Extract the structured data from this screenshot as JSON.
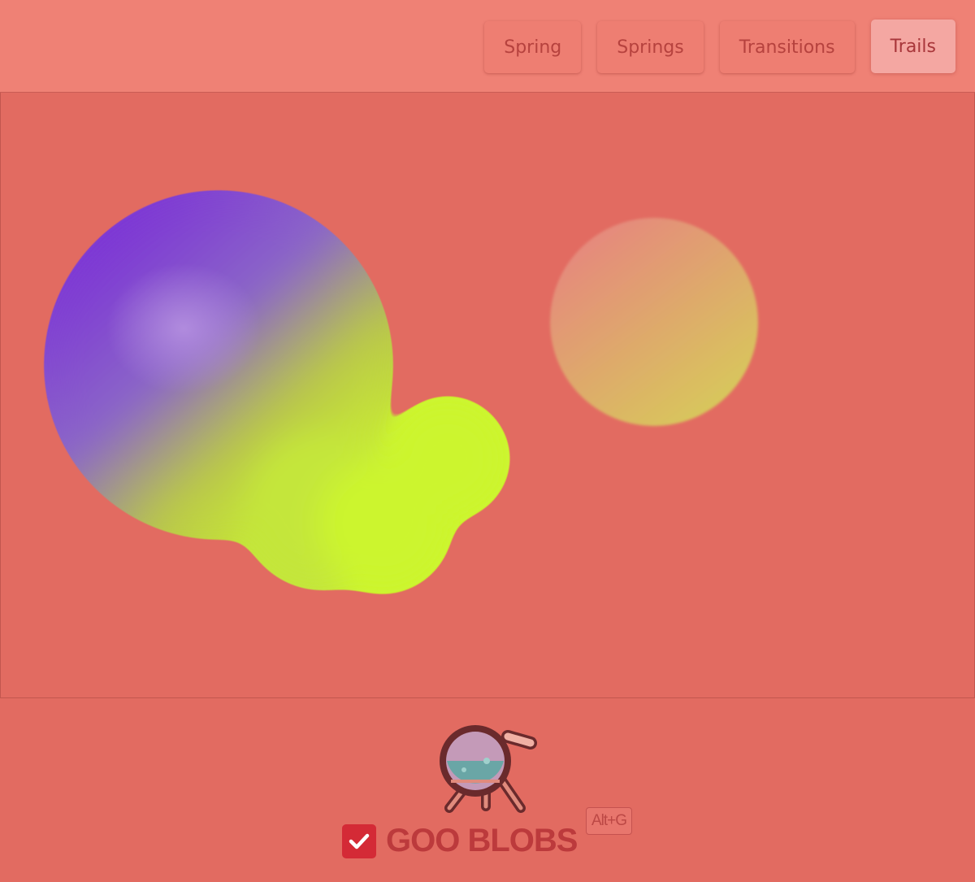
{
  "nav": {
    "tabs": [
      {
        "label": "Spring",
        "active": false
      },
      {
        "label": "Springs",
        "active": false
      },
      {
        "label": "Transitions",
        "active": false
      },
      {
        "label": "Trails",
        "active": true
      }
    ]
  },
  "footer": {
    "goo_toggle_label": "GOO BLOBS",
    "goo_toggle_checked": true,
    "shortcut": "Alt+G"
  },
  "colors": {
    "background": "#e26b61",
    "topbar": "#ef8175",
    "active_tab": "#f4a7a2",
    "checkbox": "#d42a36",
    "blob_purple": "#7b2fd6",
    "blob_lime": "#ccf52d",
    "blob_peach": "#e58a7c"
  },
  "icons": {
    "logo": "flask-icon",
    "checkbox": "checkmark-icon"
  }
}
